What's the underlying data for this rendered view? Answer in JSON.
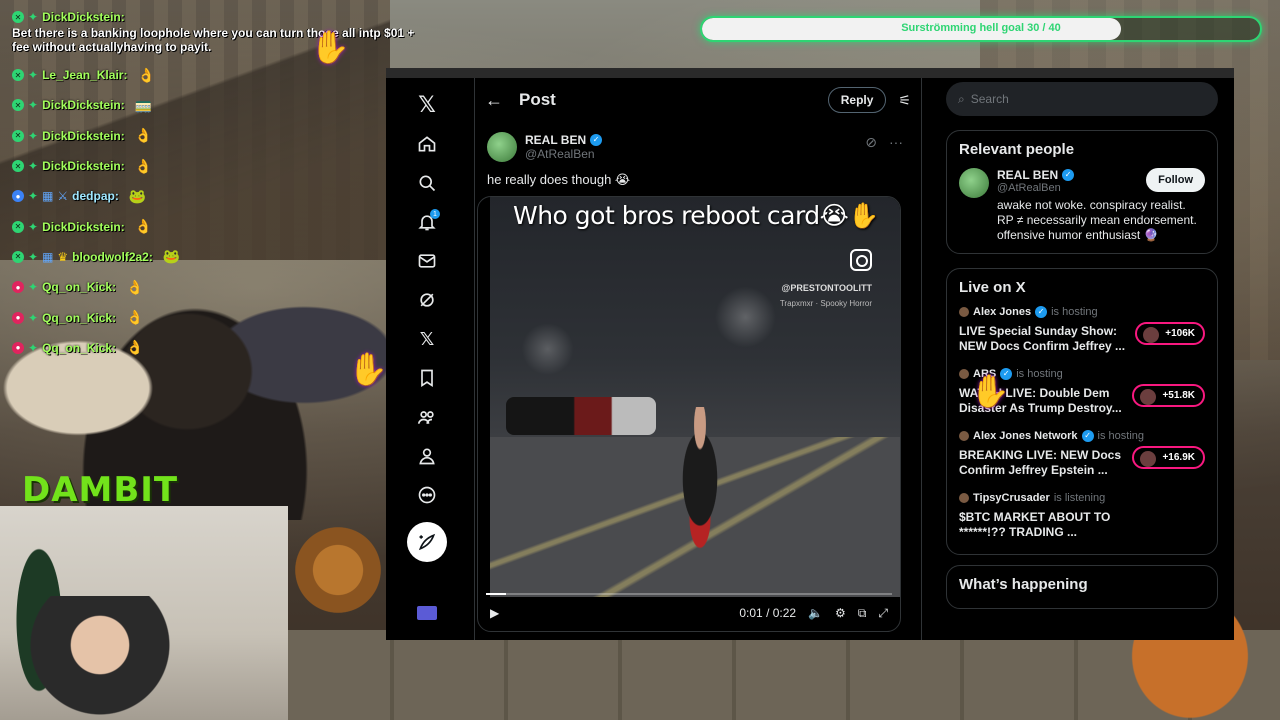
{
  "goal": {
    "label": "Surströmming hell goal 30 / 40",
    "current": 30,
    "target": 40,
    "accent": "#2ed573"
  },
  "chat": {
    "first": {
      "name": "DickDickstein:"
    },
    "first_message": "Bet there is a banking loophole where you can turn those all intp $01 + fee without actuallyhaving to payit.",
    "rows": [
      {
        "name": "Le_Jean_Klair:",
        "emote": "👌"
      },
      {
        "name": "DickDickstein:",
        "emote": "🚃"
      },
      {
        "name": "DickDickstein:",
        "emote": "👌"
      },
      {
        "name": "DickDickstein:",
        "emote": "👌"
      },
      {
        "name": "dedpap:",
        "emote": "🐸"
      },
      {
        "name": "DickDickstein:",
        "emote": "👌"
      },
      {
        "name": "bloodwolf2a2:",
        "emote": "🐸"
      },
      {
        "name": "Qq_on_Kick:",
        "emote": "👌"
      },
      {
        "name": "Qq_on_Kick:",
        "emote": "👌"
      },
      {
        "name": "Qq_on_Kick:",
        "emote": "👌"
      }
    ]
  },
  "overlay_logo": "DAMBIT",
  "x": {
    "nav": [
      "x-logo",
      "home",
      "search",
      "notifications",
      "messages",
      "grok",
      "premium",
      "bookmarks",
      "communities",
      "profile",
      "more"
    ],
    "notification_count": "1",
    "header": {
      "title": "Post",
      "reply_label": "Reply"
    },
    "post": {
      "author_name": "REAL BEN",
      "author_handle": "@AtRealBen",
      "text": "he really does though 😭",
      "video_caption": "Who got bros reboot card😭✋",
      "watermark_handle": "@PRESTONTOOLITT",
      "watermark_music": "Trapxmxr · Spooky Horror",
      "time": "0:01 / 0:22",
      "progress": 0.05
    },
    "search_placeholder": "Search",
    "relevant": {
      "title": "Relevant people",
      "name": "REAL BEN",
      "handle": "@AtRealBen",
      "follow": "Follow",
      "bio": "awake not woke. conspiracy realist. RP ≠ necessarily mean endorsement. offensive humor enthusiast 🔮"
    },
    "live": {
      "title": "Live on X",
      "items": [
        {
          "host": "Alex Jones",
          "status": "is hosting",
          "title": "LIVE Special Sunday Show: NEW Docs Confirm Jeffrey ...",
          "count": "+106K"
        },
        {
          "host": "ARS",
          "status": "is hosting",
          "title": "WATCH LIVE: Double Dem Disaster As Trump Destroy...",
          "count": "+51.8K"
        },
        {
          "host": "Alex Jones Network",
          "status": "is hosting",
          "title": "BREAKING LIVE: NEW Docs Confirm Jeffrey Epstein ...",
          "count": "+16.9K"
        },
        {
          "host": "TipsyCrusader",
          "status": "is listening",
          "title": "$BTC MARKET ABOUT TO ******!?? TRADING ...",
          "count": ""
        }
      ]
    },
    "whats_happening": "What’s happening"
  }
}
